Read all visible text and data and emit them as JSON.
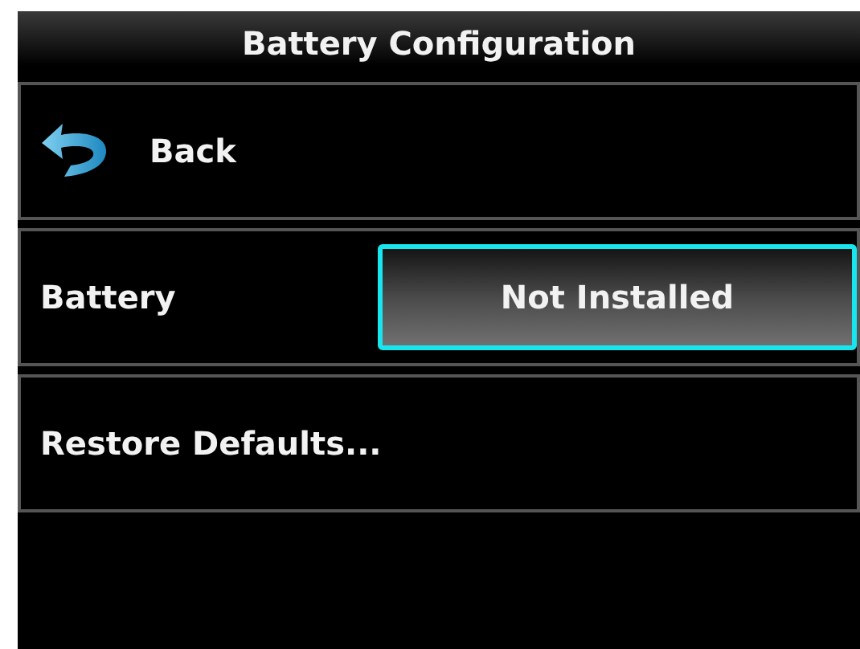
{
  "window": {
    "title": "Battery Configuration"
  },
  "rows": [
    {
      "kind": "back",
      "label": "Back"
    },
    {
      "kind": "setting",
      "label": "Battery",
      "value": "Not Installed",
      "selected": true
    },
    {
      "kind": "action",
      "label": "Restore Defaults..."
    }
  ]
}
